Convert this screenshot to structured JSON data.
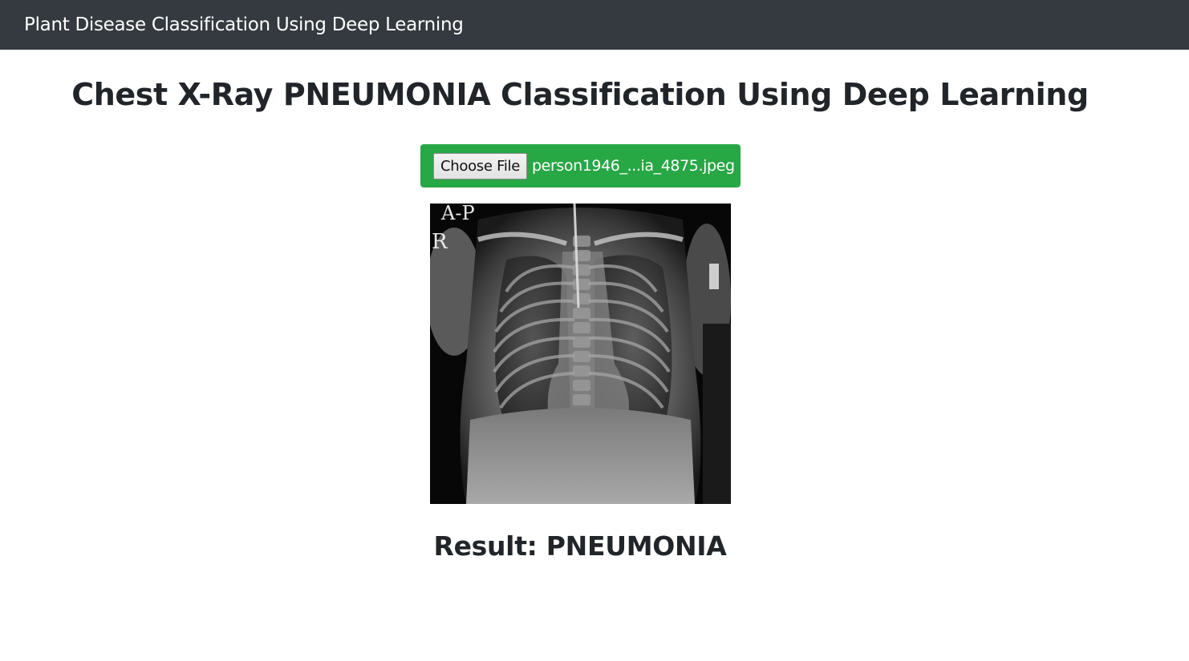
{
  "navbar": {
    "brand": "Plant Disease Classification Using Deep Learning"
  },
  "main": {
    "title": "Chest X-Ray PNEUMONIA Classification Using Deep Learning",
    "upload": {
      "button_label": "Choose File",
      "file_name": "person1946_...ia_4875.jpeg"
    },
    "xray_image": {
      "markers": [
        "A-P",
        "R"
      ]
    },
    "result": {
      "label": "Result: PNEUMONIA"
    }
  },
  "colors": {
    "navbar_bg": "#343a40",
    "upload_bg": "#28a745",
    "text": "#212529"
  }
}
